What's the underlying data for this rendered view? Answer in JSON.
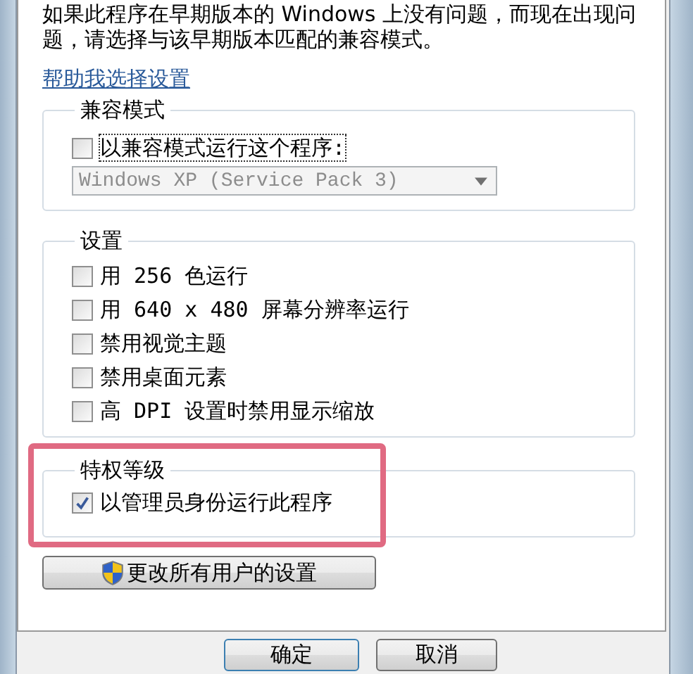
{
  "description_lines": [
    "如果此程序在早期版本的 Windows 上没有问题，而现在出现问",
    "题，请选择与该早期版本匹配的兼容模式。"
  ],
  "help_link": "帮助我选择设置",
  "compatibility_mode": {
    "title": "兼容模式",
    "checkbox": {
      "label": "以兼容模式运行这个程序:",
      "checked": false,
      "focused": true
    },
    "dropdown": {
      "value": "Windows XP (Service Pack 3)",
      "disabled": true
    }
  },
  "settings": {
    "title": "设置",
    "items": [
      {
        "label": "用 256 色运行",
        "checked": false
      },
      {
        "label": "用 640 x 480 屏幕分辨率运行",
        "checked": false
      },
      {
        "label": "禁用视觉主题",
        "checked": false
      },
      {
        "label": "禁用桌面元素",
        "checked": false
      },
      {
        "label": "高 DPI 设置时禁用显示缩放",
        "checked": false
      }
    ]
  },
  "privilege_level": {
    "title": "特权等级",
    "highlighted": true,
    "items": [
      {
        "label": "以管理员身份运行此程序",
        "checked": true
      }
    ]
  },
  "all_users_button": "更改所有用户的设置",
  "dialog_buttons": [
    "确定",
    "取消"
  ]
}
